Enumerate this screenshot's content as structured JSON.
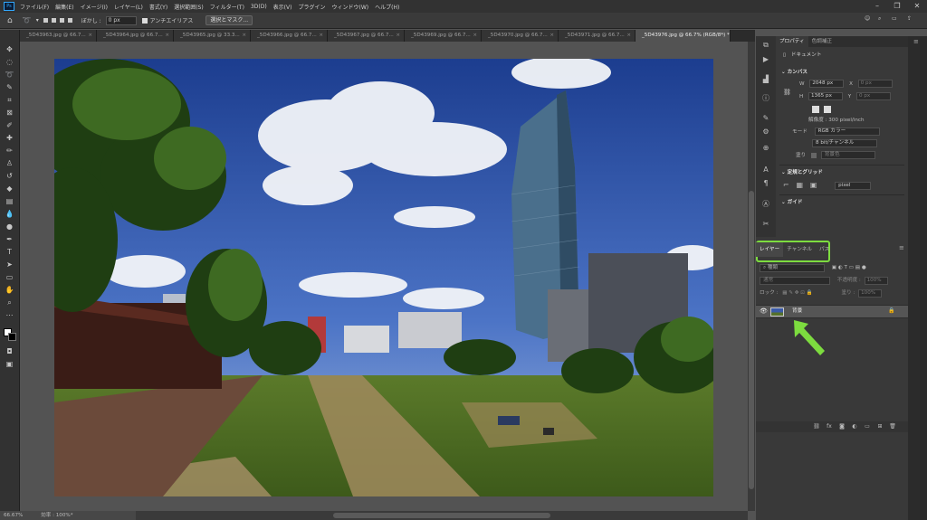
{
  "app": {
    "logo": "Ps"
  },
  "menu": [
    "ファイル(F)",
    "編集(E)",
    "イメージ(I)",
    "レイヤー(L)",
    "書式(Y)",
    "選択範囲(S)",
    "フィルター(T)",
    "3D(D)",
    "表示(V)",
    "プラグイン",
    "ウィンドウ(W)",
    "ヘルプ(H)"
  ],
  "options": {
    "feather_label": "ぼかし :",
    "feather_value": "0 px",
    "antialias_label": "アンチエイリアス",
    "mask_button": "選択とマスク..."
  },
  "tabs": [
    {
      "label": "_5D43963.jpg @ 66.7..."
    },
    {
      "label": "_5D43964.jpg @ 66.7..."
    },
    {
      "label": "_5D43965.jpg @ 33.3..."
    },
    {
      "label": "_5D43966.jpg @ 66.7..."
    },
    {
      "label": "_5D43967.jpg @ 66.7..."
    },
    {
      "label": "_5D43969.jpg @ 66.7..."
    },
    {
      "label": "_5D43970.jpg @ 66.7..."
    },
    {
      "label": "_5D43971.jpg @ 66.7..."
    },
    {
      "label": "_5D43976.jpg @ 66.7% (RGB/8*) *",
      "active": true
    }
  ],
  "status": {
    "zoom": "66.67%",
    "efficiency": "効率 : 100%*"
  },
  "properties": {
    "tabs": [
      "プロパティ",
      "色調補正"
    ],
    "doc_label": "ドキュメント",
    "canvas_section": "カンバス",
    "w_label": "W",
    "w_value": "2048 px",
    "x_label": "X",
    "x_value": "0 px",
    "h_label": "H",
    "h_value": "1365 px",
    "y_label": "Y",
    "y_value": "0 px",
    "resolution": "解像度 : 300 pixel/inch",
    "mode_label": "モード",
    "mode_value": "RGB カラー",
    "depth_value": "8 bit/チャンネル",
    "fill_label": "塗り",
    "fill_value": "背景色",
    "rulers_section": "定規とグリッド",
    "unit_value": "pixel",
    "guides_section": "ガイド"
  },
  "layers": {
    "tabs": [
      "レイヤー",
      "チャンネル",
      "パス"
    ],
    "kind": "種類",
    "blend": "通常",
    "opacity_label": "不透明度 :",
    "opacity_value": "100%",
    "lock_label": "ロック :",
    "fill_label": "塗り :",
    "fill_value": "100%",
    "items": [
      {
        "name": "背景"
      }
    ]
  },
  "colors": {
    "highlight": "#7ddc3f",
    "accent": "#31a8ff"
  }
}
